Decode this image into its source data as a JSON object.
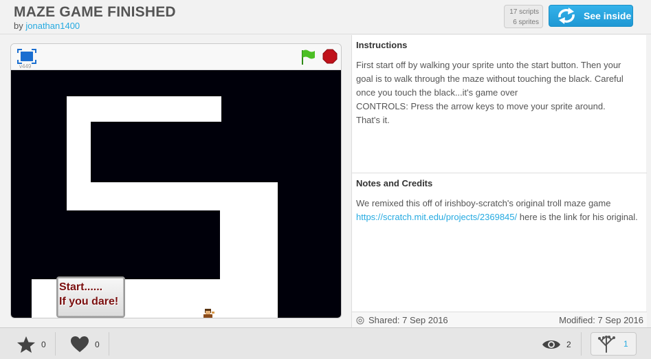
{
  "project": {
    "title": "MAZE GAME FINISHED",
    "by": "by",
    "author": "jonathan1400",
    "scripts_count": "17 scripts",
    "sprites_count": "6 sprites",
    "see_inside": "See inside"
  },
  "player": {
    "version": "v449",
    "start_sign_line1": "Start......",
    "start_sign_line2": "If you dare!",
    "colors": {
      "maze_black": "#00000a",
      "maze_path": "#ffffff",
      "flag": "#4cbf24",
      "stop": "#c0121b",
      "sign_text": "#7a0e0e"
    }
  },
  "instructions": {
    "heading": "Instructions",
    "line1": "First start off by walking your sprite unto the start button. Then your goal is to walk through the maze without touching the black. Careful once you touch the black...it's game over",
    "line2": "CONTROLS: Press the arrow keys to move your sprite around.",
    "line3": "That's it."
  },
  "notes": {
    "heading": "Notes and Credits",
    "text_before": "We remixed this off of irishboy-scratch's original troll maze game",
    "link": "https://scratch.mit.edu/projects/2369845/",
    "text_after": "here is the link for his original."
  },
  "meta": {
    "shared": "Shared: 7 Sep 2016",
    "modified": "Modified: 7 Sep 2016"
  },
  "footer": {
    "favorites": "0",
    "loves": "0",
    "views": "2",
    "remixes": "1"
  },
  "accent": "#25aae1"
}
